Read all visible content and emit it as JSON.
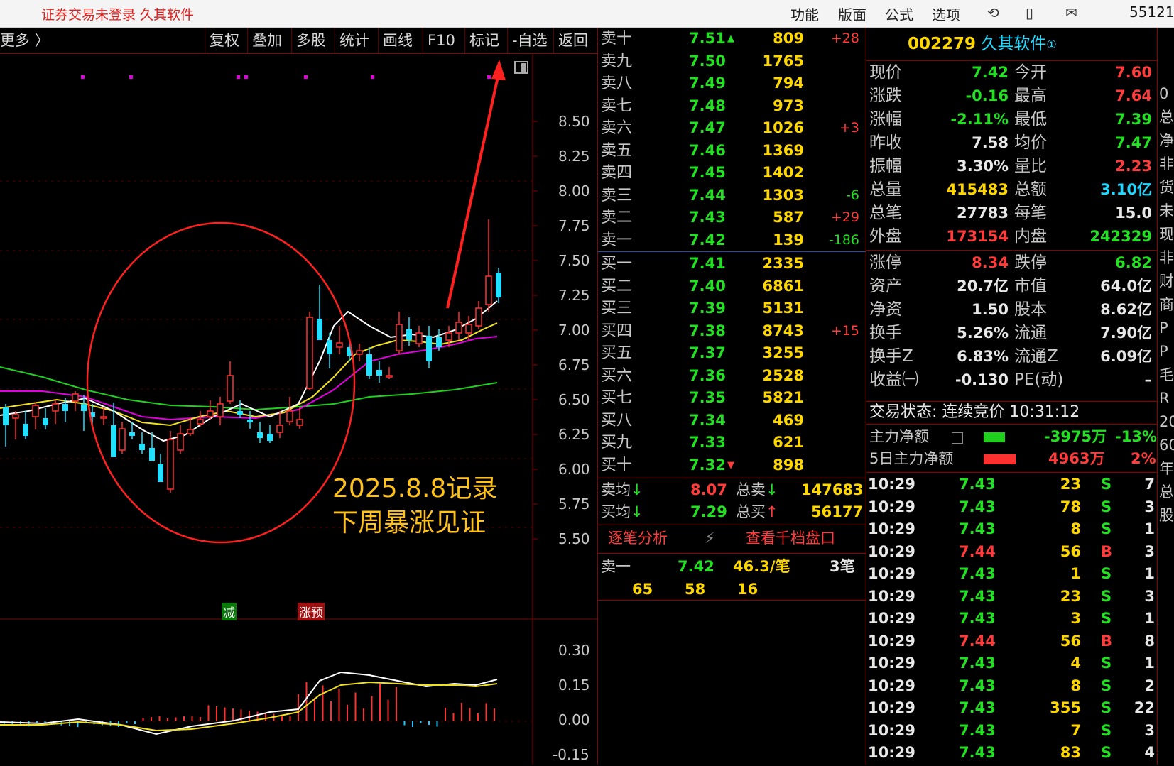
{
  "titlebar": {
    "app_title": "证券交易未登录  久其软件",
    "menus": [
      "功能",
      "版面",
      "公式",
      "选项"
    ],
    "right_number": "55121"
  },
  "toolbar": {
    "more": "更多 〉",
    "buttons": [
      "复权",
      "叠加",
      "多股",
      "统计",
      "画线",
      "F10",
      "标记",
      "-自选",
      "返回"
    ]
  },
  "chart": {
    "price_axis": [
      "8.50",
      "8.25",
      "8.00",
      "7.75",
      "7.50",
      "7.25",
      "7.00",
      "6.75",
      "6.50",
      "6.25",
      "6.00",
      "5.75",
      "5.50"
    ],
    "indicator_axis": [
      "0.30",
      "0.15",
      "0.00",
      "-0.15"
    ],
    "annotation_line1": "2025.8.8记录",
    "annotation_line2": "下周暴涨见证",
    "marker_reduce": "减",
    "marker_forecast": "涨预"
  },
  "orderbook": {
    "sells": [
      {
        "label": "卖十",
        "price": "7.51",
        "vol": "809",
        "chg": "+28",
        "flag": "up"
      },
      {
        "label": "卖九",
        "price": "7.50",
        "vol": "1765",
        "chg": ""
      },
      {
        "label": "卖八",
        "price": "7.49",
        "vol": "794",
        "chg": ""
      },
      {
        "label": "卖七",
        "price": "7.48",
        "vol": "973",
        "chg": ""
      },
      {
        "label": "卖六",
        "price": "7.47",
        "vol": "1026",
        "chg": "+3"
      },
      {
        "label": "卖五",
        "price": "7.46",
        "vol": "1369",
        "chg": ""
      },
      {
        "label": "卖四",
        "price": "7.45",
        "vol": "1402",
        "chg": ""
      },
      {
        "label": "卖三",
        "price": "7.44",
        "vol": "1303",
        "chg": "-6"
      },
      {
        "label": "卖二",
        "price": "7.43",
        "vol": "587",
        "chg": "+29"
      },
      {
        "label": "卖一",
        "price": "7.42",
        "vol": "139",
        "chg": "-186"
      }
    ],
    "buys": [
      {
        "label": "买一",
        "price": "7.41",
        "vol": "2335",
        "chg": ""
      },
      {
        "label": "买二",
        "price": "7.40",
        "vol": "6861",
        "chg": ""
      },
      {
        "label": "买三",
        "price": "7.39",
        "vol": "5131",
        "chg": ""
      },
      {
        "label": "买四",
        "price": "7.38",
        "vol": "8743",
        "chg": "+15"
      },
      {
        "label": "买五",
        "price": "7.37",
        "vol": "3255",
        "chg": ""
      },
      {
        "label": "买六",
        "price": "7.36",
        "vol": "2528",
        "chg": ""
      },
      {
        "label": "买七",
        "price": "7.35",
        "vol": "5821",
        "chg": ""
      },
      {
        "label": "买八",
        "price": "7.34",
        "vol": "469",
        "chg": ""
      },
      {
        "label": "买九",
        "price": "7.33",
        "vol": "621",
        "chg": ""
      },
      {
        "label": "买十",
        "price": "7.32",
        "vol": "898",
        "chg": "",
        "flag": "down"
      }
    ],
    "avg_sell_label": "卖均",
    "avg_sell": "8.07",
    "total_sell_label": "总卖",
    "total_sell": "147683",
    "avg_buy_label": "买均",
    "avg_buy": "7.29",
    "total_buy_label": "总买",
    "total_buy": "56177",
    "tick_analysis": "逐笔分析",
    "view_depth": "查看千档盘口",
    "first_sell_label": "卖一",
    "first_sell_price": "7.42",
    "per_trade": "46.3/笔",
    "trade_count": "3笔",
    "queue": [
      "65",
      "58",
      "16"
    ]
  },
  "quote": {
    "code": "002279",
    "name": "久其软件",
    "badge": "①",
    "rows": [
      {
        "l1": "现价",
        "v1": "7.42",
        "c1": "green",
        "l2": "今开",
        "v2": "7.60",
        "c2": "red"
      },
      {
        "l1": "涨跌",
        "v1": "-0.16",
        "c1": "green",
        "l2": "最高",
        "v2": "7.64",
        "c2": "red"
      },
      {
        "l1": "涨幅",
        "v1": "-2.11%",
        "c1": "green",
        "l2": "最低",
        "v2": "7.39",
        "c2": "green"
      },
      {
        "l1": "昨收",
        "v1": "7.58",
        "c1": "white",
        "l2": "均价",
        "v2": "7.47",
        "c2": "green"
      },
      {
        "l1": "振幅",
        "v1": "3.30%",
        "c1": "white",
        "l2": "量比",
        "v2": "2.23",
        "c2": "red"
      },
      {
        "l1": "总量",
        "v1": "415483",
        "c1": "yellow",
        "l2": "总额",
        "v2": "3.10亿",
        "c2": "cyan"
      },
      {
        "l1": "总笔",
        "v1": "27783",
        "c1": "white",
        "l2": "每笔",
        "v2": "15.0",
        "c2": "white"
      },
      {
        "l1": "外盘",
        "v1": "173154",
        "c1": "red",
        "l2": "内盘",
        "v2": "242329",
        "c2": "green"
      }
    ],
    "rows2": [
      {
        "l1": "涨停",
        "v1": "8.34",
        "c1": "red",
        "l2": "跌停",
        "v2": "6.82",
        "c2": "green"
      },
      {
        "l1": "资产",
        "v1": "20.7亿",
        "c1": "white",
        "l2": "市值",
        "v2": "64.0亿",
        "c2": "white"
      },
      {
        "l1": "净资",
        "v1": "1.50",
        "c1": "white",
        "l2": "股本",
        "v2": "8.62亿",
        "c2": "white"
      },
      {
        "l1": "换手",
        "v1": "5.26%",
        "c1": "white",
        "l2": "流通",
        "v2": "7.90亿",
        "c2": "white"
      },
      {
        "l1": "换手Z",
        "v1": "6.83%",
        "c1": "white",
        "l2": "流通Z",
        "v2": "6.09亿",
        "c2": "white"
      },
      {
        "l1": "收益㈠",
        "v1": "-0.130",
        "c1": "white",
        "l2": "PE(动)",
        "v2": "–",
        "c2": "white"
      }
    ],
    "trade_status": "交易状态: 连续竞价 10:31:12",
    "main_net_label": "主力净额",
    "main_net": "-3975万",
    "main_net_pct": "-13%",
    "main5_label": "5日主力净额",
    "main5": "4963万",
    "main5_pct": "2%"
  },
  "ticks": [
    {
      "time": "10:29",
      "price": "7.43",
      "vol": "23",
      "side": "S",
      "n": "7"
    },
    {
      "time": "10:29",
      "price": "7.43",
      "vol": "78",
      "side": "S",
      "n": "3"
    },
    {
      "time": "10:29",
      "price": "7.43",
      "vol": "8",
      "side": "S",
      "n": "1"
    },
    {
      "time": "10:29",
      "price": "7.44",
      "vol": "56",
      "side": "B",
      "n": "3"
    },
    {
      "time": "10:29",
      "price": "7.43",
      "vol": "1",
      "side": "S",
      "n": "1"
    },
    {
      "time": "10:29",
      "price": "7.43",
      "vol": "23",
      "side": "S",
      "n": "3"
    },
    {
      "time": "10:29",
      "price": "7.43",
      "vol": "3",
      "side": "S",
      "n": "1"
    },
    {
      "time": "10:29",
      "price": "7.44",
      "vol": "56",
      "side": "B",
      "n": "8"
    },
    {
      "time": "10:29",
      "price": "7.43",
      "vol": "4",
      "side": "S",
      "n": "1"
    },
    {
      "time": "10:29",
      "price": "7.43",
      "vol": "8",
      "side": "S",
      "n": "2"
    },
    {
      "time": "10:29",
      "price": "7.43",
      "vol": "355",
      "side": "S",
      "n": "22"
    },
    {
      "time": "10:29",
      "price": "7.43",
      "vol": "7",
      "side": "S",
      "n": "3"
    },
    {
      "time": "10:29",
      "price": "7.43",
      "vol": "83",
      "side": "S",
      "n": "4"
    }
  ],
  "edge_column": [
    "0",
    "总",
    "净",
    "非",
    "货",
    "未",
    "现",
    "非",
    "财",
    "商",
    "P",
    "P",
    "毛",
    "R",
    "20",
    "60",
    "年",
    "总",
    "股"
  ]
}
